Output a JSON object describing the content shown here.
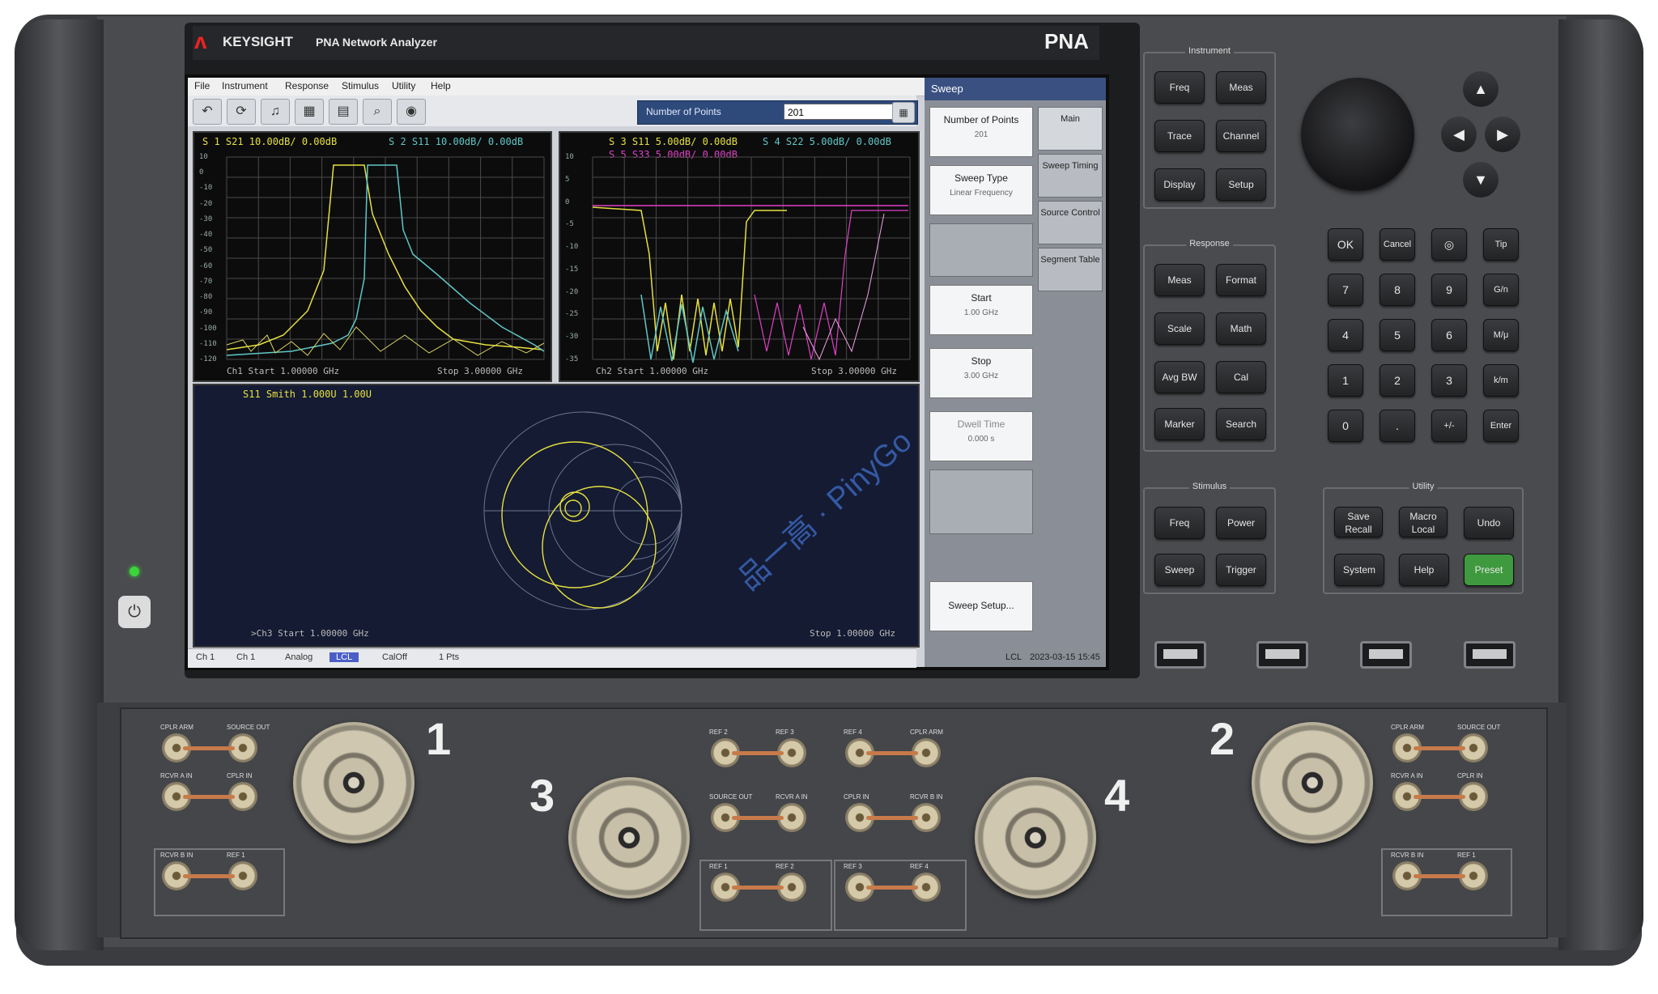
{
  "brand": {
    "logo_glyph": "ʌ",
    "name": "KEYSIGHT",
    "description": "PNA Network Analyzer",
    "model_label": "PNA"
  },
  "menu": [
    "File",
    "Instrument",
    "Response",
    "Stimulus",
    "Utility",
    "Help"
  ],
  "toolbar": {
    "buttons": [
      "↶",
      "⟳",
      "♫",
      "▦",
      "▤",
      "⌕",
      "◉"
    ],
    "entry_label": "Number of Points",
    "entry_value": "201"
  },
  "plots": {
    "top_left": {
      "trace_title_1": "S 1  S21 10.00dB/ 0.00dB",
      "trace_title_2": "S 2  S11 10.00dB/ 0.00dB",
      "footer_left": "Ch1  Start  1.00000 GHz",
      "footer_right": "Stop  3.00000 GHz",
      "yticks": [
        "10",
        "0",
        "-10",
        "-20",
        "-30",
        "-40",
        "-50",
        "-60",
        "-70",
        "-80",
        "-90",
        "-100",
        "-110",
        "-120"
      ]
    },
    "top_right": {
      "trace_title_1": "S 3  S11 5.00dB/ 0.00dB",
      "trace_title_2": "S 4  S22 5.00dB/ 0.00dB",
      "trace_title_3": "S 5  S33 5.00dB/ 0.00dB",
      "footer_left": "Ch2  Start  1.00000 GHz",
      "footer_right": "Stop  3.00000 GHz",
      "yticks": [
        "10",
        "5",
        "0",
        "-5",
        "-10",
        "-15",
        "-20",
        "-25",
        "-30",
        "-35"
      ]
    },
    "bottom": {
      "trace_title": "S11 Smith 1.000U  1.00U",
      "footer_left": ">Ch3  Start  1.00000 GHz",
      "footer_right": "Stop  1.00000 GHz"
    }
  },
  "statusbar": [
    "Ch 1",
    "Ch 1",
    "Analog",
    "LCL",
    "CalOff",
    "1 Pts"
  ],
  "statusbar_right": [
    "LCL",
    "2023-03-15  15:45"
  ],
  "softkeys": {
    "title": "Sweep",
    "items": [
      {
        "label": "Number of Points",
        "value": "201"
      },
      {
        "label": "Sweep Type",
        "value": "Linear Frequency"
      },
      {
        "label": "Start",
        "value": "1.00 GHz"
      },
      {
        "label": "Stop",
        "value": "3.00 GHz"
      },
      {
        "label": "Dwell Time",
        "value": "0.000 s"
      },
      {
        "label": "Sweep Setup..."
      }
    ],
    "tabs": [
      "Main",
      "Sweep Timing",
      "Source Control",
      "Segment Table"
    ]
  },
  "keys": {
    "instrument": {
      "title": "Instrument",
      "keys": [
        "Freq",
        "Meas",
        "Trace",
        "Channel",
        "Display",
        "Setup"
      ]
    },
    "response": {
      "title": "Response",
      "keys": [
        "Meas",
        "Format",
        "Scale",
        "Math",
        "Avg BW",
        "Cal",
        "Marker",
        "Search"
      ]
    },
    "stimulus": {
      "title": "Stimulus",
      "keys": [
        "Freq",
        "Power",
        "Sweep",
        "Trigger"
      ]
    },
    "utility": {
      "title": "Utility",
      "keys": [
        "Save Recall",
        "Macro Local",
        "Undo",
        "System",
        "Help",
        "Preset"
      ]
    },
    "numpad": [
      "OK",
      "Cancel",
      "◎",
      "Tip",
      "7",
      "8",
      "9",
      "G/n",
      "4",
      "5",
      "6",
      "M/μ",
      "1",
      "2",
      "3",
      "k/m",
      "0",
      ".",
      "+/-",
      "Enter"
    ],
    "arrows": [
      "▲",
      "◀",
      "▶",
      "▼"
    ],
    "power_icon": "⏻",
    "preset_color": "#3f9a3f"
  },
  "ports": {
    "p1": "1",
    "p2": "2",
    "p3": "3",
    "p4": "4"
  },
  "coupler_labels": [
    "CPLR ARM",
    "SOURCE OUT",
    "RCVR A IN",
    "CPLR IN",
    "RCVR B IN",
    "REF 1",
    "REF 2",
    "REF 3",
    "REF 4"
  ],
  "watermark": "品一高 · PinyGo",
  "colors": {
    "trace_yellow": "#e6e040",
    "trace_cyan": "#5fc7c7",
    "trace_magenta": "#e040c8",
    "accent_blue": "#3a5080"
  }
}
